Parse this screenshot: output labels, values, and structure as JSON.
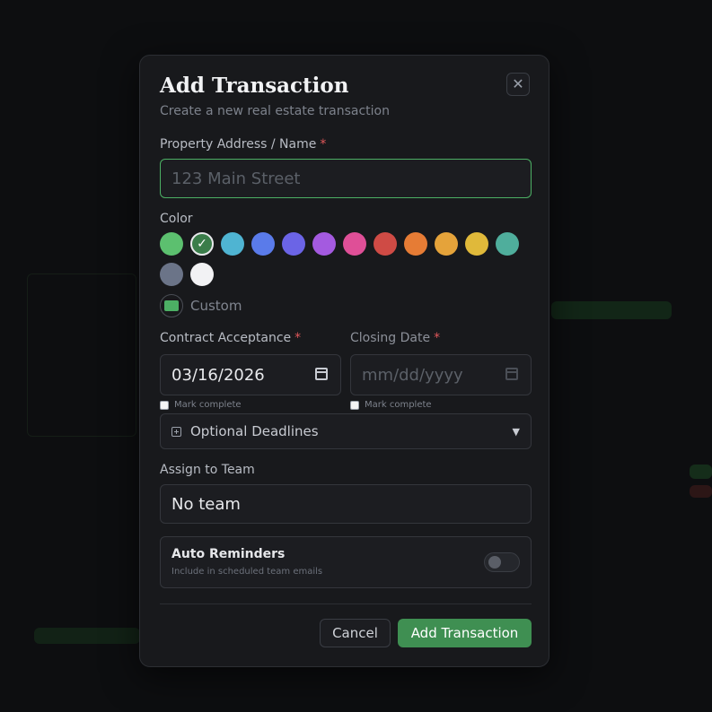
{
  "dialog": {
    "title": "Add Transaction",
    "subtitle": "Create a new real estate transaction",
    "close_icon": "close-icon"
  },
  "property": {
    "label": "Property Address / Name",
    "required_marker": "*",
    "placeholder": "123 Main Street",
    "value": ""
  },
  "color": {
    "label": "Color",
    "swatches": [
      "#5cc06f",
      "#3a7d4a",
      "#4fb4d2",
      "#5a7bea",
      "#6b64e6",
      "#a45ae0",
      "#df4f97",
      "#cf4b45",
      "#e67c35",
      "#e5a33a",
      "#e0b93a",
      "#4fae9c",
      "#6b7488",
      "#f2f2f4"
    ],
    "selected_index": 1,
    "selected_mark": "✓",
    "custom_label": "Custom",
    "custom_color": "#4caf64"
  },
  "contract": {
    "label": "Contract Acceptance",
    "required_marker": "*",
    "value": "03/16/2026",
    "mark_complete": "Mark complete"
  },
  "closing": {
    "label": "Closing Date",
    "required_marker": "*",
    "placeholder": "mm/dd/yyyy",
    "mark_complete": "Mark complete"
  },
  "optional_deadlines": {
    "label": "Optional Deadlines",
    "icon": "plus-square-icon",
    "caret": "▼"
  },
  "team": {
    "label": "Assign to Team",
    "value": "No team"
  },
  "reminders": {
    "title": "Auto Reminders",
    "subtitle": "Include in scheduled team emails",
    "enabled": false
  },
  "actions": {
    "cancel": "Cancel",
    "submit": "Add Transaction"
  },
  "colors": {
    "accent": "#3f8f52",
    "focus": "#4caf64",
    "required": "#e0575a"
  }
}
